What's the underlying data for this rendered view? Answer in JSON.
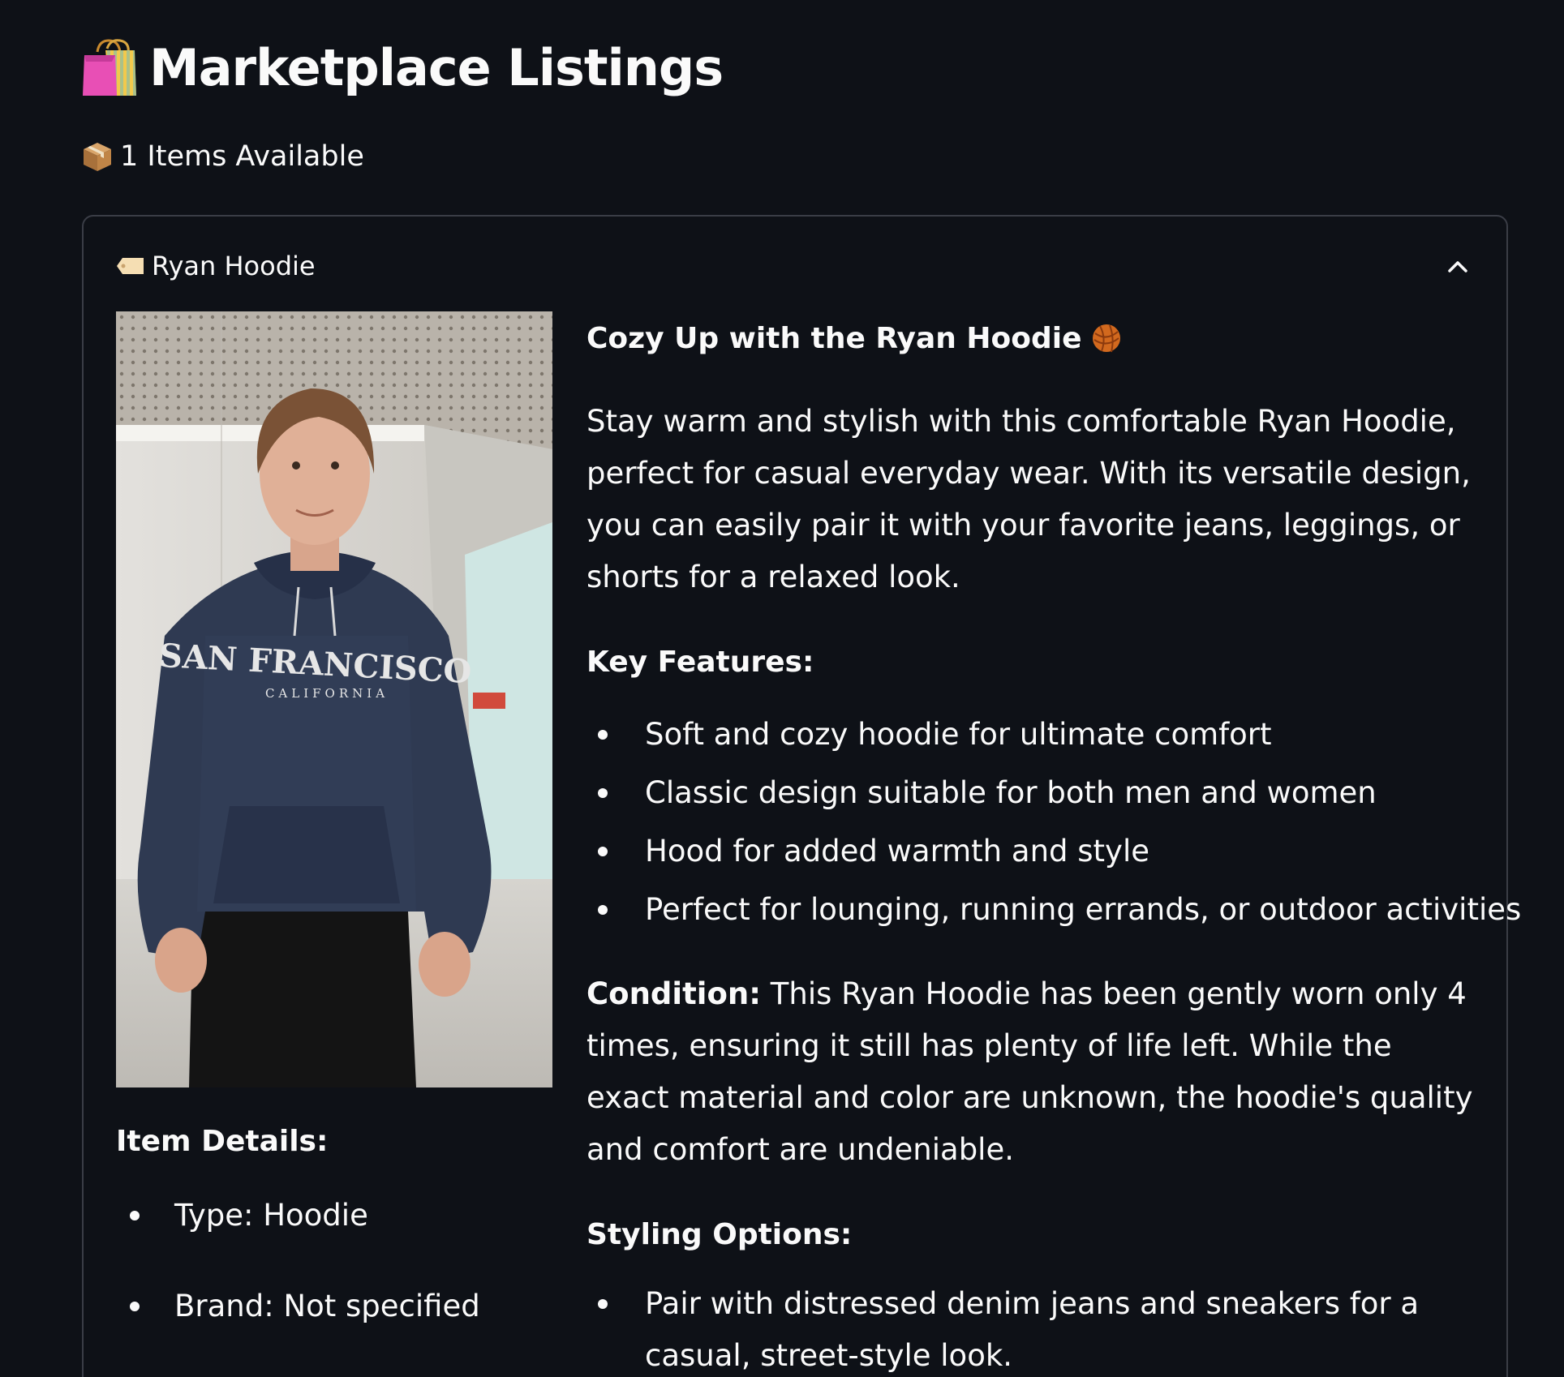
{
  "page": {
    "title": "Marketplace Listings",
    "title_icon": "shopping-bags-icon",
    "items_available": "1 Items Available",
    "items_icon": "package-icon"
  },
  "listing": {
    "header_icon": "tag-icon",
    "title": "Ryan Hoodie",
    "collapse_icon": "chevron-up-icon",
    "image_alt": "Person wearing a navy San Francisco California hoodie",
    "image_text": {
      "line1": "SAN FRANCISCO",
      "line2": "CALIFORNIA"
    },
    "item_details": {
      "heading": "Item Details:",
      "items": [
        "Type: Hoodie",
        "Brand: Not specified"
      ]
    },
    "description": {
      "heading": "Cozy Up with the Ryan Hoodie",
      "heading_icon": "yarn-ball-icon",
      "intro": "Stay warm and stylish with this comfortable Ryan Hoodie, perfect for casual everyday wear. With its versatile design, you can easily pair it with your favorite jeans, leggings, or shorts for a relaxed look.",
      "features_heading": "Key Features:",
      "features": [
        "Soft and cozy hoodie for ultimate comfort",
        "Classic design suitable for both men and women",
        "Hood for added warmth and style",
        "Perfect for lounging, running errands, or outdoor activities"
      ],
      "condition_label": "Condition:",
      "condition_text": "This Ryan Hoodie has been gently worn only 4 times, ensuring it still has plenty of life left. While the exact material and color are unknown, the hoodie's quality and comfort are undeniable.",
      "styling_heading": "Styling Options:",
      "styling": [
        "Pair with distressed denim jeans and sneakers for a casual, street-style look."
      ]
    }
  },
  "colors": {
    "background": "#0e1117",
    "text": "#fafafa",
    "border": "#3a3d46"
  }
}
